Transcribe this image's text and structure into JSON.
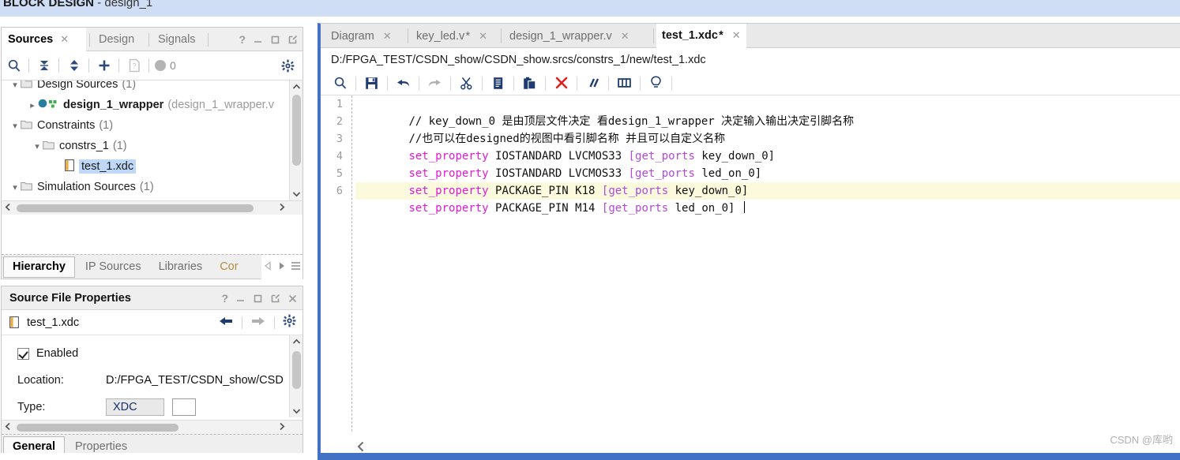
{
  "titlebar": {
    "prefix": "BLOCK DESIGN",
    "separator": " - ",
    "design_name": "design_1",
    "accent_color": "#cfddf5"
  },
  "sources_panel": {
    "tabs": [
      {
        "label": "Sources",
        "active": true,
        "closable": true
      },
      {
        "label": "Design",
        "active": false,
        "closable": false
      },
      {
        "label": "Signals",
        "active": false,
        "closable": false
      }
    ],
    "header_buttons": [
      "help-icon",
      "minimize-icon",
      "maximize-icon",
      "float-icon"
    ],
    "toolbar": {
      "search_icon": "search-icon",
      "collapse_icon": "collapse-all-icon",
      "expand_icon": "expand-all-icon",
      "add_icon": "add-sources-icon",
      "report_icon": "report-icon",
      "badge_count": "0",
      "gear_icon": "gear-icon"
    },
    "tree": [
      {
        "label": "Design Sources",
        "count": "(1)",
        "indent": 0,
        "expanded": true,
        "icon": "folder-icon",
        "selected": false,
        "suffix": ""
      },
      {
        "label": "design_1_wrapper",
        "count": "",
        "indent": 1,
        "expanded": false,
        "icon": "block-design-icon",
        "selected": false,
        "suffix": "(design_1_wrapper.v"
      },
      {
        "label": "Constraints",
        "count": "(1)",
        "indent": 0,
        "expanded": true,
        "icon": "folder-icon",
        "selected": false,
        "suffix": ""
      },
      {
        "label": "constrs_1",
        "count": "(1)",
        "indent": 1,
        "expanded": true,
        "icon": "folder-icon",
        "selected": false,
        "suffix": ""
      },
      {
        "label": "test_1.xdc",
        "count": "",
        "indent": 2,
        "expanded": null,
        "icon": "xdc-file-icon",
        "selected": true,
        "suffix": ""
      },
      {
        "label": "Simulation Sources",
        "count": "(1)",
        "indent": 0,
        "expanded": true,
        "icon": "folder-icon",
        "selected": false,
        "suffix": ""
      }
    ],
    "bottom_tabs": [
      {
        "label": "Hierarchy",
        "active": true
      },
      {
        "label": "IP Sources",
        "active": false
      },
      {
        "label": "Libraries",
        "active": false
      },
      {
        "label": "Cor",
        "active": false,
        "truncated": true
      }
    ],
    "bottom_nav": [
      "prev-tab-icon",
      "next-tab-icon",
      "tab-list-icon"
    ]
  },
  "source_file_properties": {
    "title": "Source File Properties",
    "header_buttons": [
      "help-icon",
      "minimize-icon",
      "maximize-icon",
      "float-icon",
      "close-icon"
    ],
    "file_name": "test_1.xdc",
    "file_icon": "xdc-file-icon",
    "nav_buttons": [
      "back-icon",
      "forward-icon",
      "gear-icon"
    ],
    "fields": [
      {
        "type": "checkbox",
        "label": "Enabled",
        "checked": true
      },
      {
        "type": "text",
        "label": "Location:",
        "value": "D:/FPGA_TEST/CSDN_show/CSD"
      },
      {
        "type": "select",
        "label": "Type:",
        "value": "XDC"
      }
    ],
    "bottom_tabs": [
      {
        "label": "General",
        "active": true
      },
      {
        "label": "Properties",
        "active": false
      }
    ]
  },
  "editor": {
    "tabs": [
      {
        "label": "Diagram",
        "active": false,
        "modified": false
      },
      {
        "label": "key_led.v",
        "active": false,
        "modified": true
      },
      {
        "label": "design_1_wrapper.v",
        "active": false,
        "modified": false
      },
      {
        "label": "test_1.xdc",
        "active": true,
        "modified": true
      }
    ],
    "file_path": "D:/FPGA_TEST/CSDN_show/CSDN_show.srcs/constrs_1/new/test_1.xdc",
    "toolbar_icons": [
      "search-icon",
      "save-icon",
      "undo-icon",
      "redo-icon",
      "cut-icon",
      "copy-icon",
      "paste-icon",
      "delete-icon",
      "comment-icon",
      "columns-icon",
      "hint-icon"
    ],
    "accent_color": "#4172c4",
    "highlight_color": "#fcfadd",
    "keyword_color": "#e31ad6",
    "bracket_color": "#b14ad8",
    "code": [
      {
        "num": "1",
        "highlighted": false,
        "tokens": [
          {
            "t": "comment",
            "v": "// key_down_0 是由顶层文件决定 看design_1_wrapper 决定输入输出决定引脚名称"
          }
        ]
      },
      {
        "num": "2",
        "highlighted": false,
        "tokens": [
          {
            "t": "comment",
            "v": "//也可以在designed的视图中看引脚名称 并且可以自定义名称"
          }
        ]
      },
      {
        "num": "3",
        "highlighted": false,
        "tokens": [
          {
            "t": "keyword",
            "v": "set_property"
          },
          {
            "t": "plain",
            "v": " IOSTANDARD LVCMOS33 "
          },
          {
            "t": "bracket",
            "v": "[get_ports"
          },
          {
            "t": "plain",
            "v": " key_down_0]"
          }
        ]
      },
      {
        "num": "4",
        "highlighted": false,
        "tokens": [
          {
            "t": "keyword",
            "v": "set_property"
          },
          {
            "t": "plain",
            "v": " IOSTANDARD LVCMOS33 "
          },
          {
            "t": "bracket",
            "v": "[get_ports"
          },
          {
            "t": "plain",
            "v": " led_on_0]"
          }
        ]
      },
      {
        "num": "5",
        "highlighted": false,
        "tokens": [
          {
            "t": "keyword",
            "v": "set_property"
          },
          {
            "t": "plain",
            "v": " PACKAGE_PIN K18 "
          },
          {
            "t": "bracket",
            "v": "[get_ports"
          },
          {
            "t": "plain",
            "v": " key_down_0]"
          }
        ]
      },
      {
        "num": "6",
        "highlighted": true,
        "caret": true,
        "tokens": [
          {
            "t": "keyword",
            "v": "set_property"
          },
          {
            "t": "plain",
            "v": " PACKAGE_PIN M14 "
          },
          {
            "t": "bracket",
            "v": "[get_ports"
          },
          {
            "t": "plain",
            "v": " led_on_0] "
          }
        ]
      }
    ],
    "bottom_scroll_icon": "scroll-left-icon"
  },
  "watermark": "CSDN @库哟"
}
